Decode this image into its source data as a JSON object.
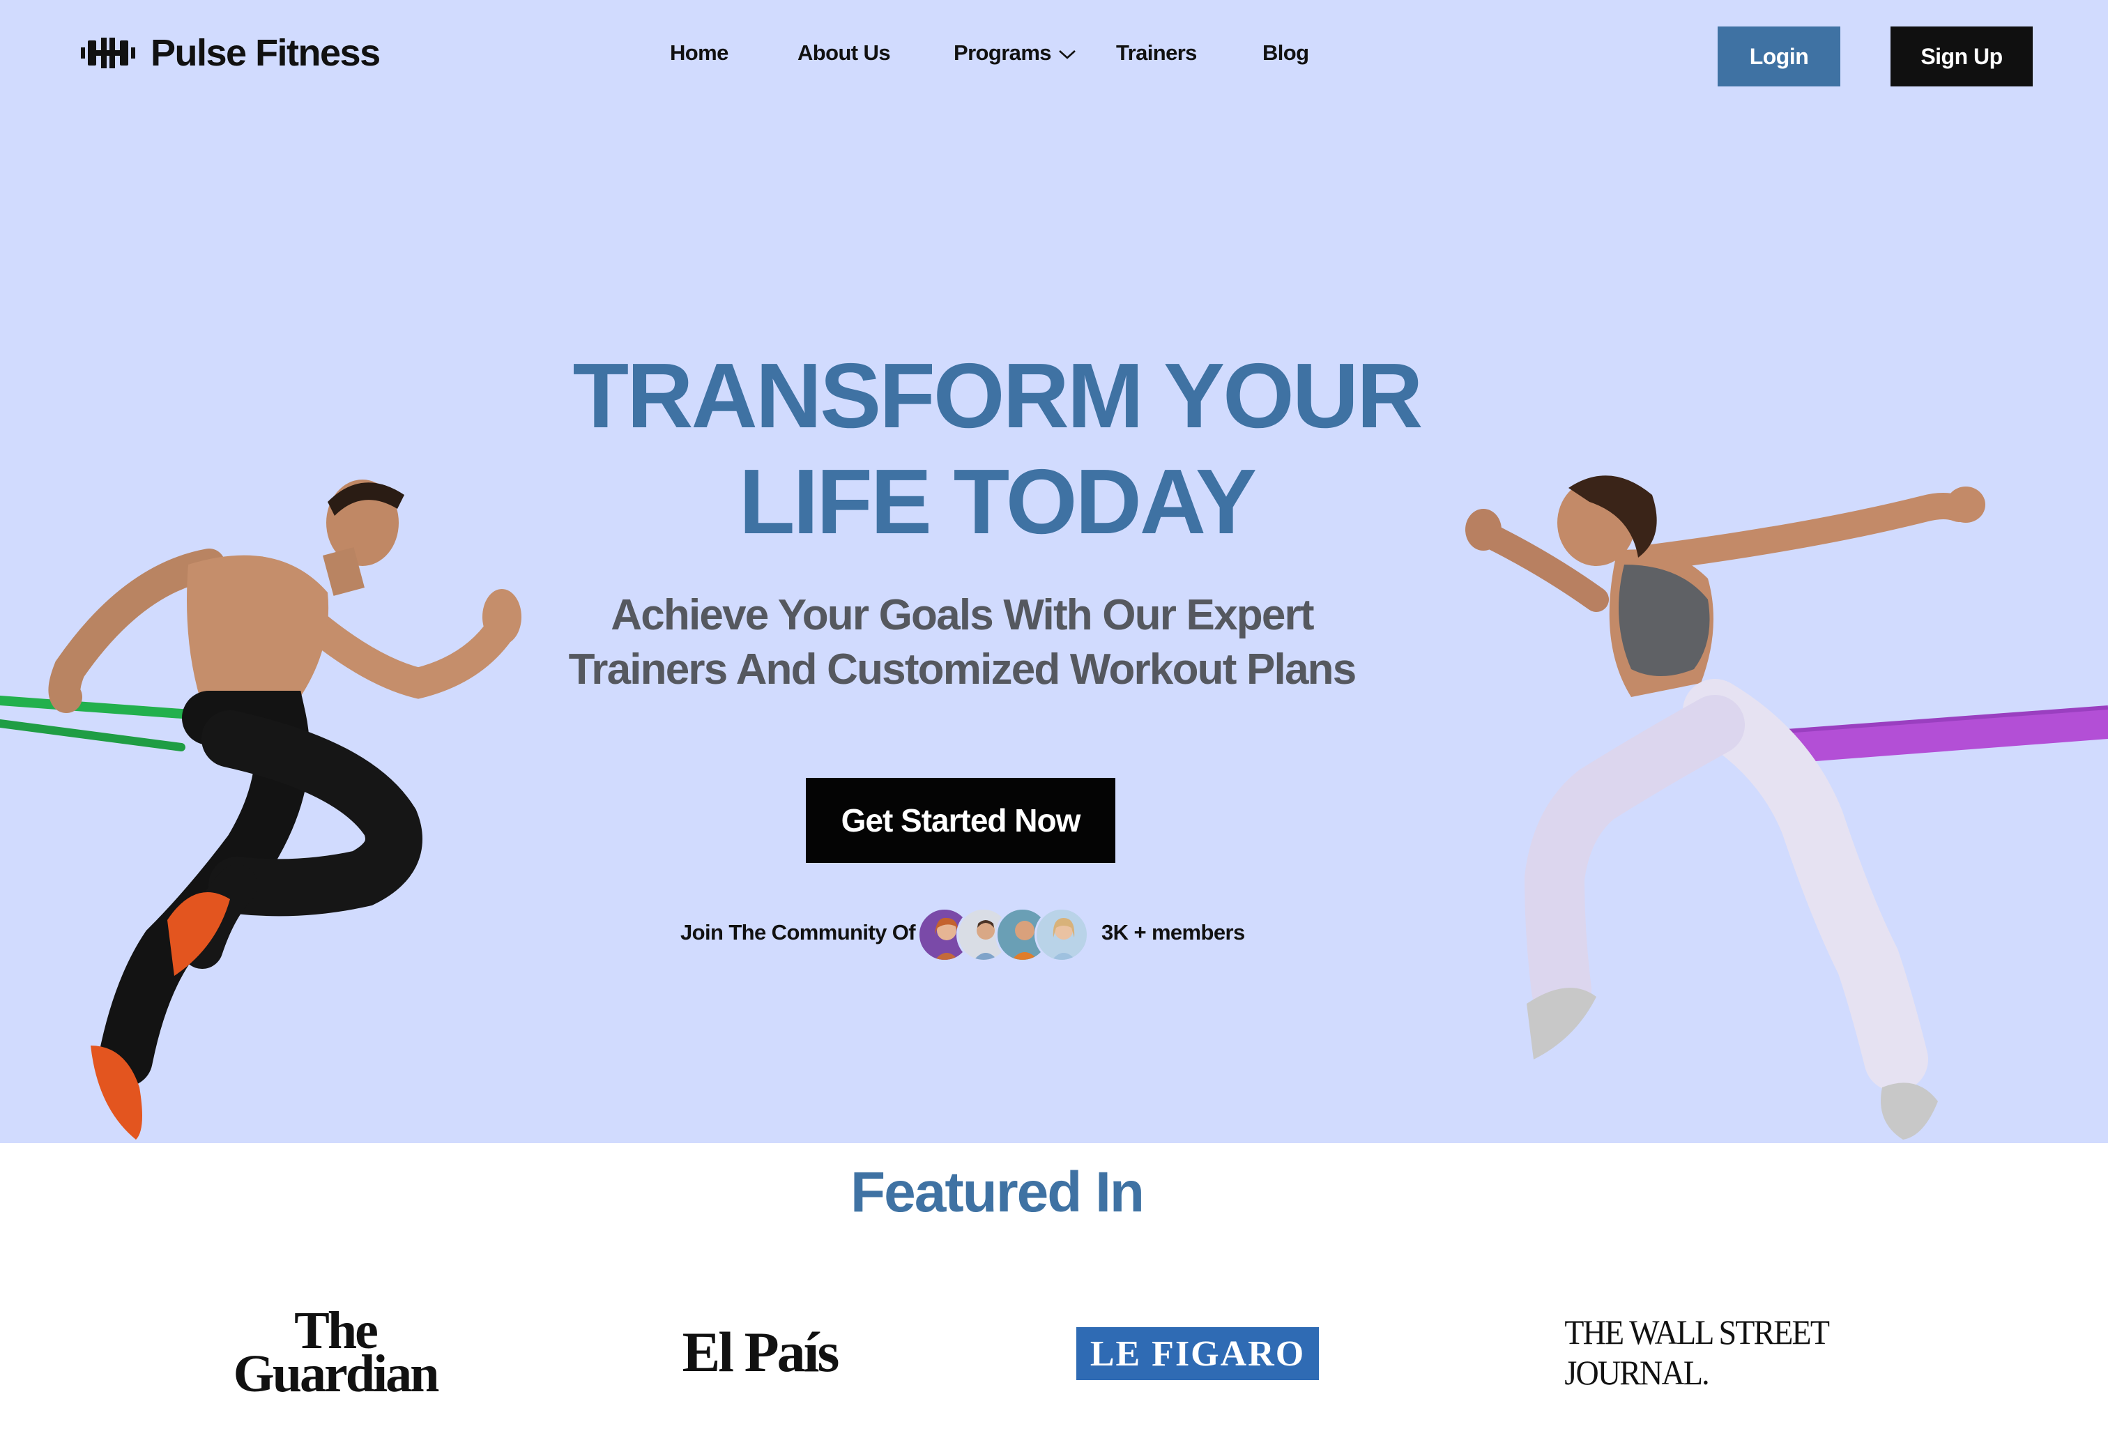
{
  "brand": {
    "name": "Pulse Fitness",
    "logo_icon": "dumbbell-icon"
  },
  "nav": {
    "items": [
      {
        "label": "Home"
      },
      {
        "label": "About Us"
      },
      {
        "label": "Programs",
        "has_dropdown": true
      },
      {
        "label": "Trainers"
      },
      {
        "label": "Blog"
      }
    ]
  },
  "auth": {
    "login_label": "Login",
    "signup_label": "Sign Up"
  },
  "hero": {
    "headline_line1": "TRANSFORM  YOUR",
    "headline_line2": "LIFE TODAY",
    "subhead_line1": "Achieve Your Goals With  Our Expert",
    "subhead_line2": "Trainers And Customized  Workout Plans",
    "cta_label": "Get Started Now",
    "community_label": "Join The Community Of",
    "members_label": "3K + members",
    "avatar_count": 4
  },
  "featured": {
    "title": "Featured In",
    "publications": {
      "guardian_line1": "The",
      "guardian_line2": "Guardian",
      "elpais": "El País",
      "figaro": "LE FIGARO",
      "wsj": "THE WALL STREET JOURNAL."
    }
  },
  "colors": {
    "hero_bg": "#d1dbfe",
    "accent": "#3f72a3",
    "dark": "#101010",
    "subhead": "#55585f",
    "figaro_bg": "#2f6bb4",
    "band_green": "#22b04d",
    "band_purple": "#b34fd6"
  }
}
